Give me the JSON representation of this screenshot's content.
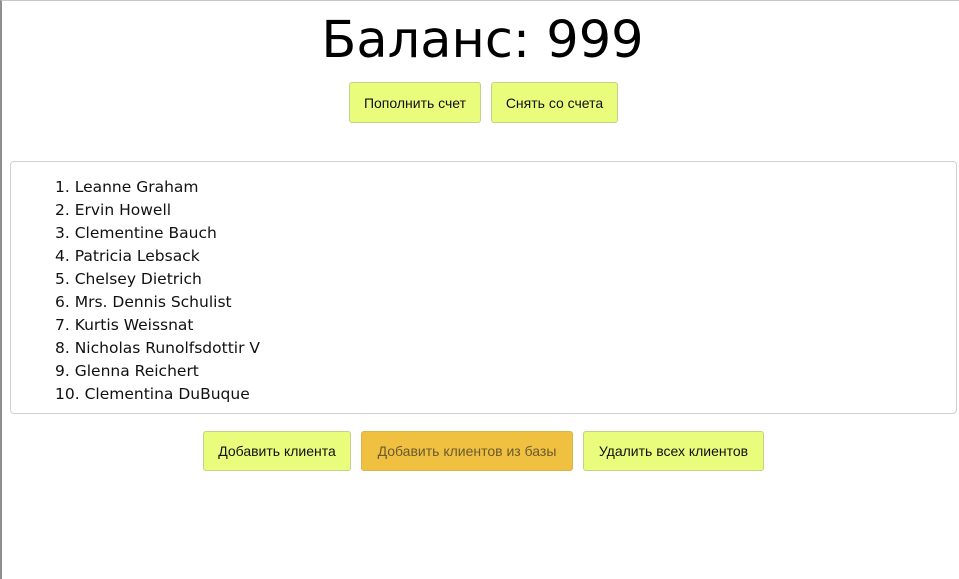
{
  "balance": {
    "label": "Баланс: 999"
  },
  "account_actions": {
    "deposit_label": "Пополнить счет",
    "withdraw_label": "Снять со счета"
  },
  "clients": [
    "1. Leanne Graham",
    "2. Ervin Howell",
    "3. Clementine Bauch",
    "4. Patricia Lebsack",
    "5. Chelsey Dietrich",
    "6. Mrs. Dennis Schulist",
    "7. Kurtis Weissnat",
    "8. Nicholas Runolfsdottir V",
    "9. Glenna Reichert",
    "10. Clementina DuBuque"
  ],
  "client_actions": {
    "add_label": "Добавить клиента",
    "add_from_db_label": "Добавить клиентов из базы",
    "delete_all_label": "Удалить всех клиентов"
  },
  "colors": {
    "button_bg": "#eafc7c",
    "button_disabled_bg": "#f0c041"
  }
}
